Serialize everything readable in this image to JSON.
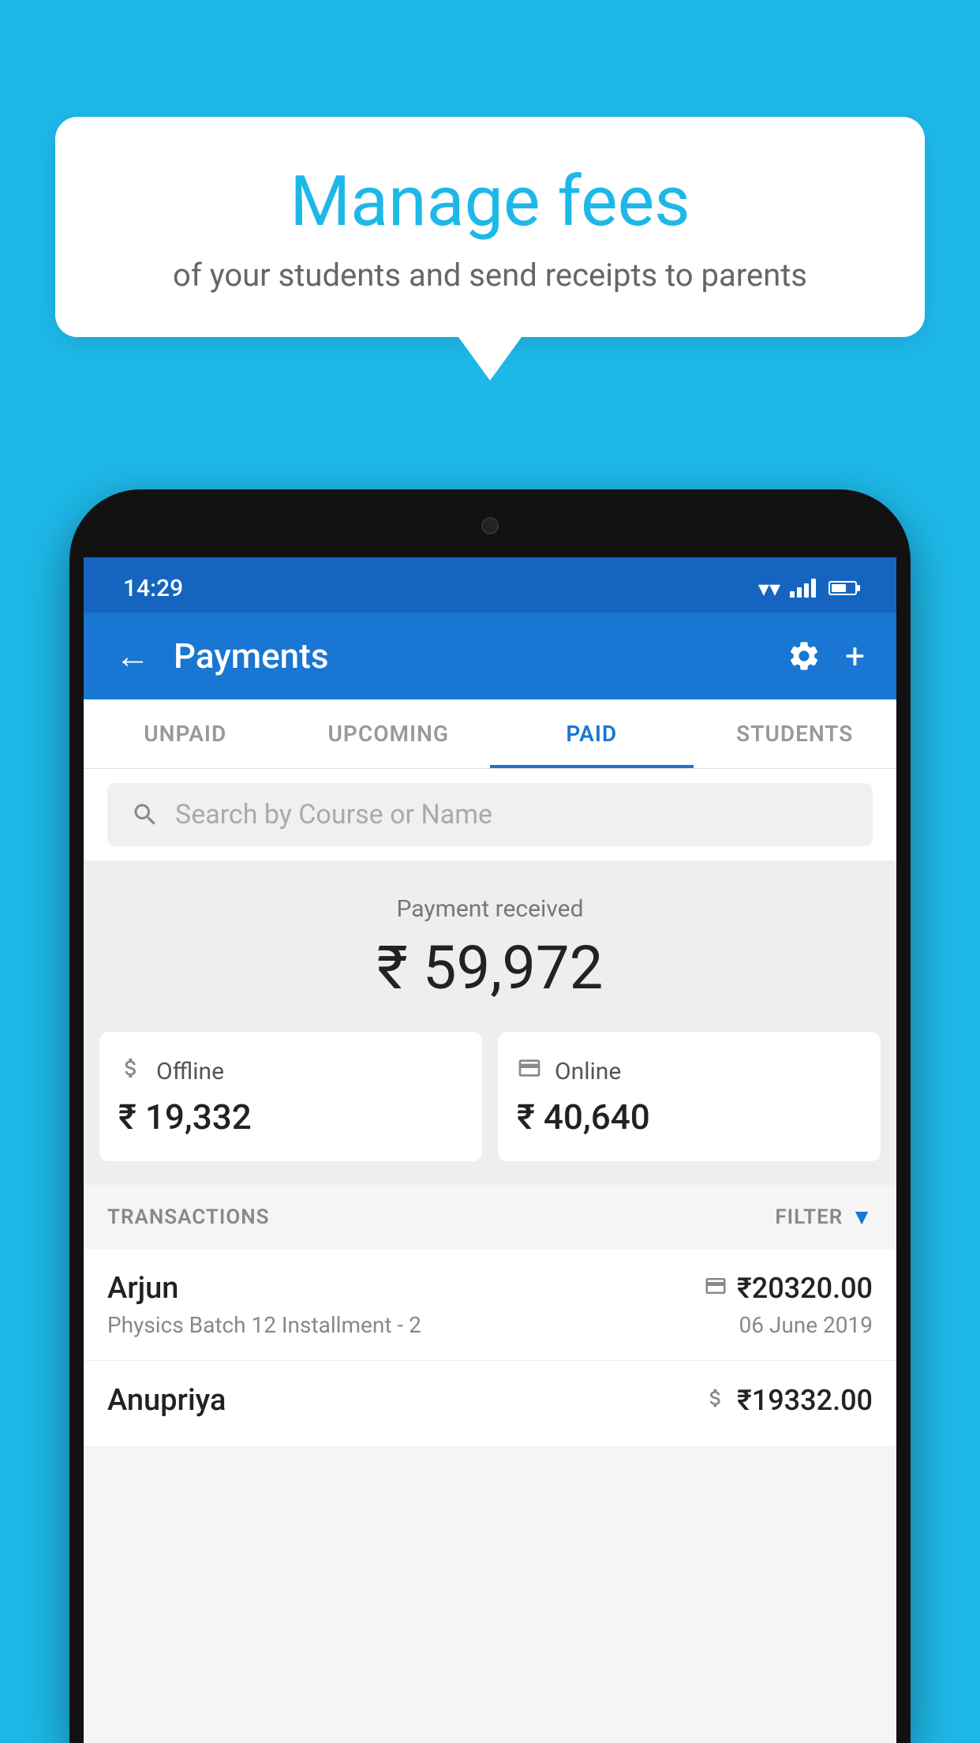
{
  "background_color": "#1eb8e8",
  "speech_bubble": {
    "title": "Manage fees",
    "subtitle": "of your students and send receipts to parents"
  },
  "status_bar": {
    "time": "14:29"
  },
  "app_bar": {
    "title": "Payments",
    "back_icon": "←",
    "settings_icon": "⚙",
    "add_icon": "+"
  },
  "tabs": [
    {
      "label": "UNPAID",
      "active": false
    },
    {
      "label": "UPCOMING",
      "active": false
    },
    {
      "label": "PAID",
      "active": true
    },
    {
      "label": "STUDENTS",
      "active": false
    }
  ],
  "search": {
    "placeholder": "Search by Course or Name"
  },
  "payment_summary": {
    "label": "Payment received",
    "amount": "₹ 59,972",
    "offline": {
      "type": "Offline",
      "amount": "₹ 19,332"
    },
    "online": {
      "type": "Online",
      "amount": "₹ 40,640"
    }
  },
  "transactions": {
    "header": "TRANSACTIONS",
    "filter_label": "FILTER",
    "rows": [
      {
        "name": "Arjun",
        "course": "Physics Batch 12 Installment - 2",
        "amount": "₹20320.00",
        "date": "06 June 2019",
        "type": "online"
      },
      {
        "name": "Anupriya",
        "course": "",
        "amount": "₹19332.00",
        "date": "",
        "type": "offline"
      }
    ]
  }
}
